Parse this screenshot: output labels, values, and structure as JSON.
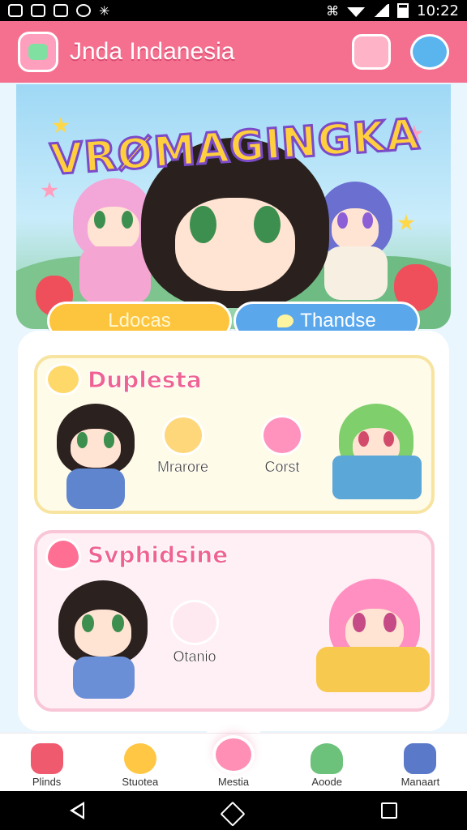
{
  "status_bar": {
    "time": "10:22"
  },
  "header": {
    "title": "Jnda Indanesia"
  },
  "hero": {
    "title": "VRØMAGINGKA",
    "buttons": [
      {
        "label": "Ldocas",
        "color": "#fdc53d"
      },
      {
        "label": "Thandse",
        "color": "#5aa7ec"
      }
    ]
  },
  "sections": [
    {
      "title": "Duplesta",
      "items": [
        {
          "label": "Mrarore",
          "icon": "chick-icon"
        },
        {
          "label": "Corst",
          "icon": "pink-bear-icon"
        }
      ]
    },
    {
      "title": "Svphidsine",
      "items": [
        {
          "label": "Otanio",
          "icon": "ghost-bunny-icon"
        }
      ]
    }
  ],
  "bottom_nav": [
    {
      "label": "Plinds",
      "icon": "house-icon"
    },
    {
      "label": "Stuotea",
      "icon": "lion-icon"
    },
    {
      "label": "Mestia",
      "icon": "bear-icon",
      "active": true
    },
    {
      "label": "Aoode",
      "icon": "frog-icon"
    },
    {
      "label": "Manaart",
      "icon": "bus-icon"
    }
  ],
  "colors": {
    "primary": "#f56f8f",
    "accent_yellow": "#fdc53d",
    "accent_blue": "#5aa7ec"
  }
}
